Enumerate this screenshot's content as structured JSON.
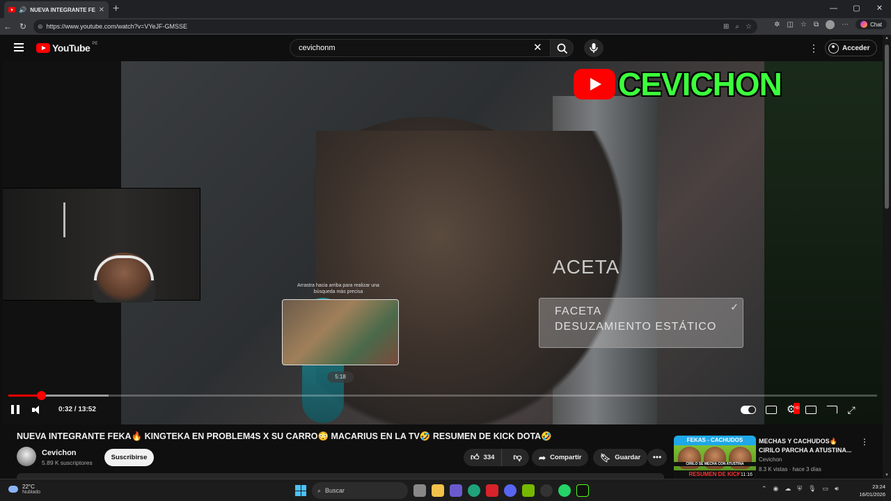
{
  "browser": {
    "tab_title": "NUEVA INTEGRANTE FEKA🔥",
    "new_tab": "+",
    "url": "https://www.youtube.com/watch?v=VYeJF-GMSSE",
    "chat_label": "Chat",
    "win_minimize": "—",
    "win_maximize": "▢",
    "win_close": "✕"
  },
  "youtube": {
    "logo_text": "YouTube",
    "country_code": "PE",
    "search_value": "cevichonm",
    "signin_label": "Acceder"
  },
  "player": {
    "brand_name": "CEVICHON",
    "faceta_heading": "ACETA",
    "faceta_line1": "FACETA",
    "faceta_line2": "DESUZAMIENTO ESTÁTICO",
    "preview_hint": "Arrastra hacia arriba para realizar una búsqueda más precisa",
    "preview_time": "5:18",
    "current_time": "0:32 / 13:52",
    "played_fraction": 0.038,
    "buffered_fraction": 0.115,
    "hover_fraction": 0.382
  },
  "video": {
    "title": "NUEVA INTEGRANTE FEKA🔥 KINGTEKA EN PROBLEM4S X SU CARRO😳 MACARIUS EN LA TV🤣 RESUMEN DE KICK DOTA🤣",
    "channel_name": "Cevichon",
    "subscribers": "5.89 K suscriptores",
    "subscribe_label": "Suscribirse",
    "likes": "334",
    "share_label": "Compartir",
    "save_label": "Guardar",
    "more_label": "•••"
  },
  "recommended": {
    "title": "MECHAS Y CACHUDOS🔥 CIRILO PARCHA A ATUSTINA...",
    "channel": "Cevichon",
    "meta": "8.3 K vistas · hace 3 días",
    "thumb_top": "FEKAS - CACHUDOS",
    "thumb_bottom": "RESUMEN DE KICK",
    "thumb_mid": "CIRILO SE MECHA CON ATUSTINA",
    "duration": "11:16"
  },
  "taskbar": {
    "temperature": "22°C",
    "weather": "Nublado",
    "search_placeholder": "Buscar",
    "time": "23:24",
    "date": "16/01/2026"
  }
}
